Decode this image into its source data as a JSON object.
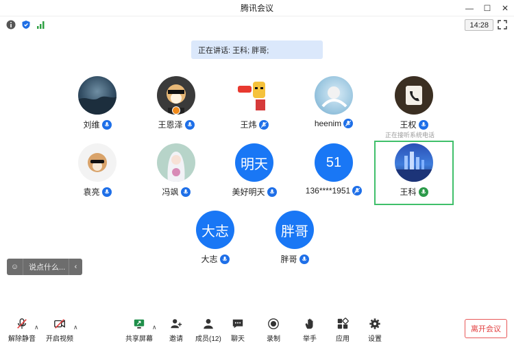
{
  "window": {
    "title": "腾讯会议"
  },
  "status": {
    "time": "14:28"
  },
  "speaking": {
    "text": "正在讲话: 王科; 胖哥;"
  },
  "participants": [
    {
      "name": "刘维",
      "avatar_text": ""
    },
    {
      "name": "王恩泽",
      "avatar_text": ""
    },
    {
      "name": "王炜",
      "avatar_text": ""
    },
    {
      "name": "heenim",
      "avatar_text": ""
    },
    {
      "name": "王权",
      "avatar_text": "",
      "note": "正在接听系统电话"
    },
    {
      "name": "袁亮",
      "avatar_text": ""
    },
    {
      "name": "冯飒",
      "avatar_text": ""
    },
    {
      "name": "美好明天",
      "avatar_text": "明天"
    },
    {
      "name": "136****1951",
      "avatar_text": "51"
    },
    {
      "name": "王科",
      "avatar_text": ""
    },
    {
      "name": "大志",
      "avatar_text": "大志"
    },
    {
      "name": "胖哥",
      "avatar_text": "胖哥"
    }
  ],
  "chat": {
    "placeholder": "说点什么..."
  },
  "toolbar": {
    "unmute": "解除静音",
    "start_video": "开启视频",
    "share": "共享屏幕",
    "invite": "邀请",
    "members": "成员(12)",
    "chat": "聊天",
    "record": "录制",
    "raise_hand": "举手",
    "apps": "应用",
    "settings": "设置",
    "leave": "离开会议"
  },
  "colors": {
    "accent": "#1977f5",
    "active_border": "#3fbf6a",
    "leave": "#e23c3c",
    "speaking_bg": "#dbe8fb"
  }
}
